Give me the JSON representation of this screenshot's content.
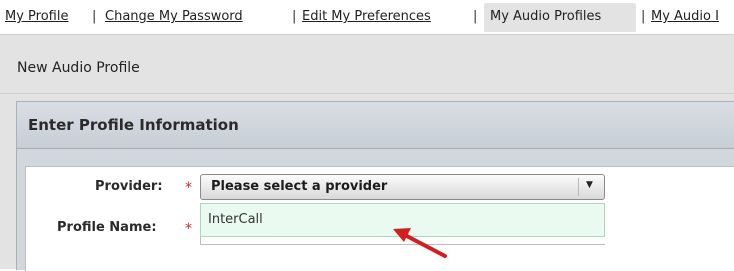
{
  "nav": {
    "items": [
      {
        "label": "My Profile"
      },
      {
        "label": "Change My Password"
      },
      {
        "label": "Edit My Preferences"
      },
      {
        "label": "My Audio Profiles"
      },
      {
        "label": "My Audio I"
      }
    ],
    "separator": "|"
  },
  "page": {
    "title": "New Audio Profile"
  },
  "section": {
    "title": "Enter Profile Information"
  },
  "form": {
    "provider_label": "Provider:",
    "required_mark": "*",
    "provider_selected": "Please select a provider",
    "provider_options": [
      "InterCall"
    ],
    "profile_name_label": "Profile Name:",
    "profile_name_value": ""
  },
  "colors": {
    "required": "#cc2a2a",
    "annotation_arrow": "#d21e1e",
    "dropdown_bg": "#eafaf1"
  },
  "icons": {
    "select_arrow": "chevron-down-icon",
    "annotation": "red-arrow-annotation"
  }
}
